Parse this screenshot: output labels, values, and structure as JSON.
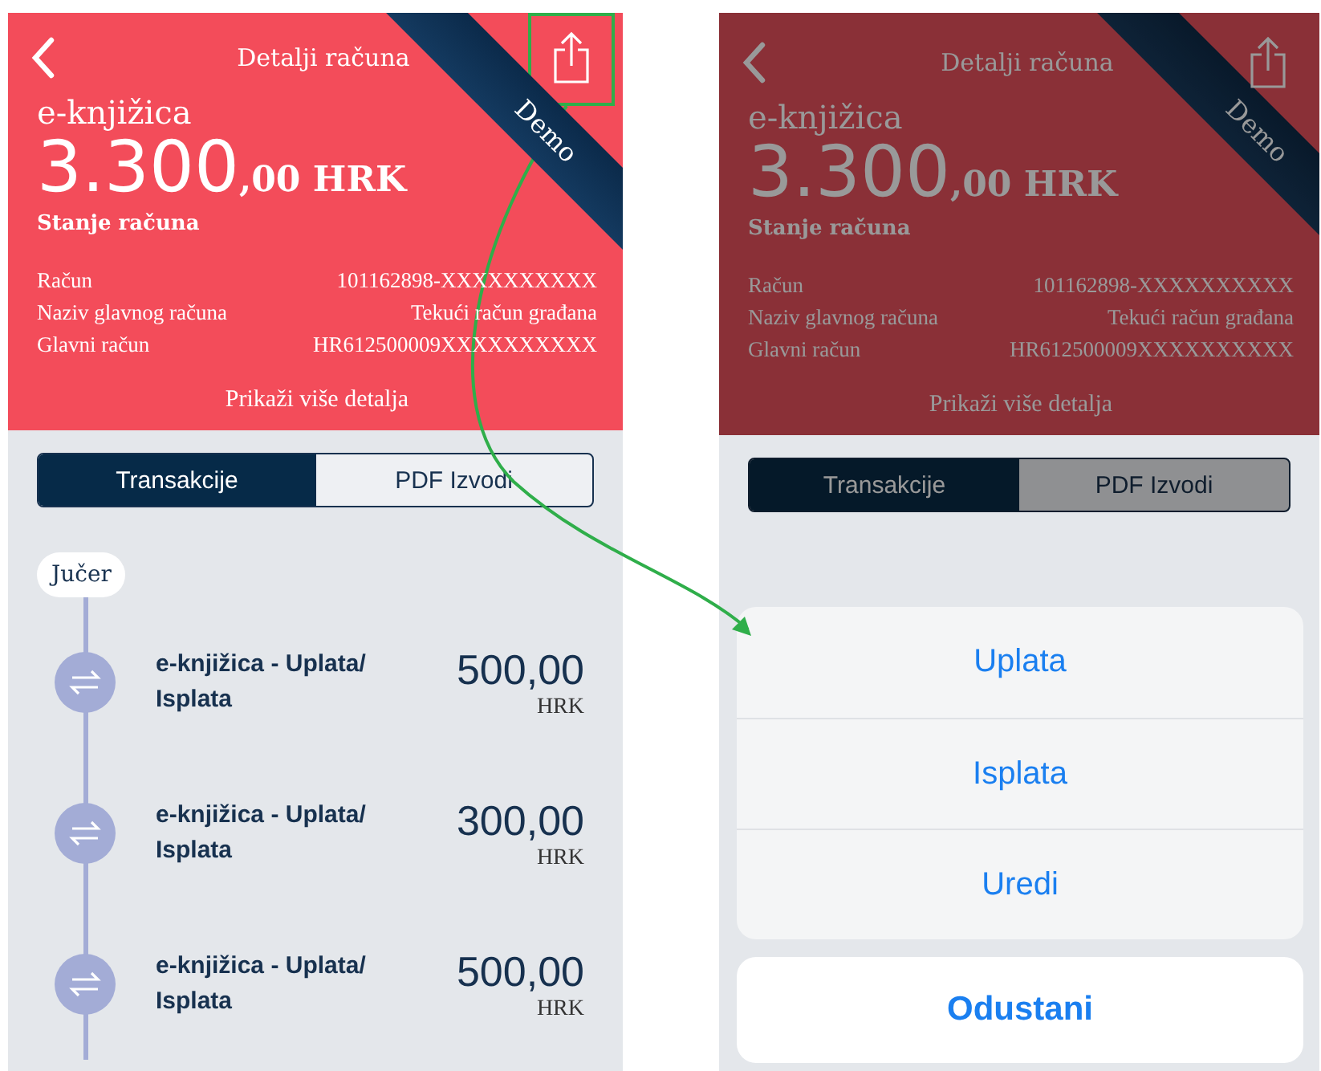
{
  "screens": [
    {
      "dimmed": false,
      "header": {
        "title": "Detalji računa",
        "account_type": "e-knjižica",
        "amount_main": "3.300",
        "amount_rest": ",00 HRK",
        "balance_label": "Stanje računa",
        "ribbon": "Demo",
        "more_link": "Prikaži više detalja",
        "details": [
          {
            "label": "Račun",
            "value": "101162898-XXXXXXXXXX"
          },
          {
            "label": "Naziv glavnog računa",
            "value": "Tekući račun građana"
          },
          {
            "label": "Glavni račun",
            "value": "HR612500009XXXXXXXXXX"
          }
        ]
      },
      "tabs": [
        {
          "label": "Transakcije",
          "selected": true
        },
        {
          "label": "PDF Izvodi",
          "selected": false
        }
      ],
      "timeline": {
        "date": "Jučer",
        "items": [
          {
            "title": "e-knjižica - Uplata/ Isplata",
            "amount": "500,00",
            "currency": "HRK"
          },
          {
            "title": "e-knjižica - Uplata/ Isplata",
            "amount": "300,00",
            "currency": "HRK"
          },
          {
            "title": "e-knjižica - Uplata/ Isplata",
            "amount": "500,00",
            "currency": "HRK"
          }
        ]
      }
    },
    {
      "dimmed": true,
      "header": {
        "title": "Detalji računa",
        "account_type": "e-knjižica",
        "amount_main": "3.300",
        "amount_rest": ",00 HRK",
        "balance_label": "Stanje računa",
        "ribbon": "Demo",
        "more_link": "Prikaži više detalja",
        "details": [
          {
            "label": "Račun",
            "value": "101162898-XXXXXXXXXX"
          },
          {
            "label": "Naziv glavnog računa",
            "value": "Tekući račun građana"
          },
          {
            "label": "Glavni račun",
            "value": "HR612500009XXXXXXXXXX"
          }
        ]
      },
      "tabs": [
        {
          "label": "Transakcije",
          "selected": true
        },
        {
          "label": "PDF Izvodi",
          "selected": false
        }
      ],
      "action_sheet": {
        "actions": [
          "Uplata",
          "Isplata",
          "Uredi"
        ],
        "cancel": "Odustani"
      }
    }
  ]
}
